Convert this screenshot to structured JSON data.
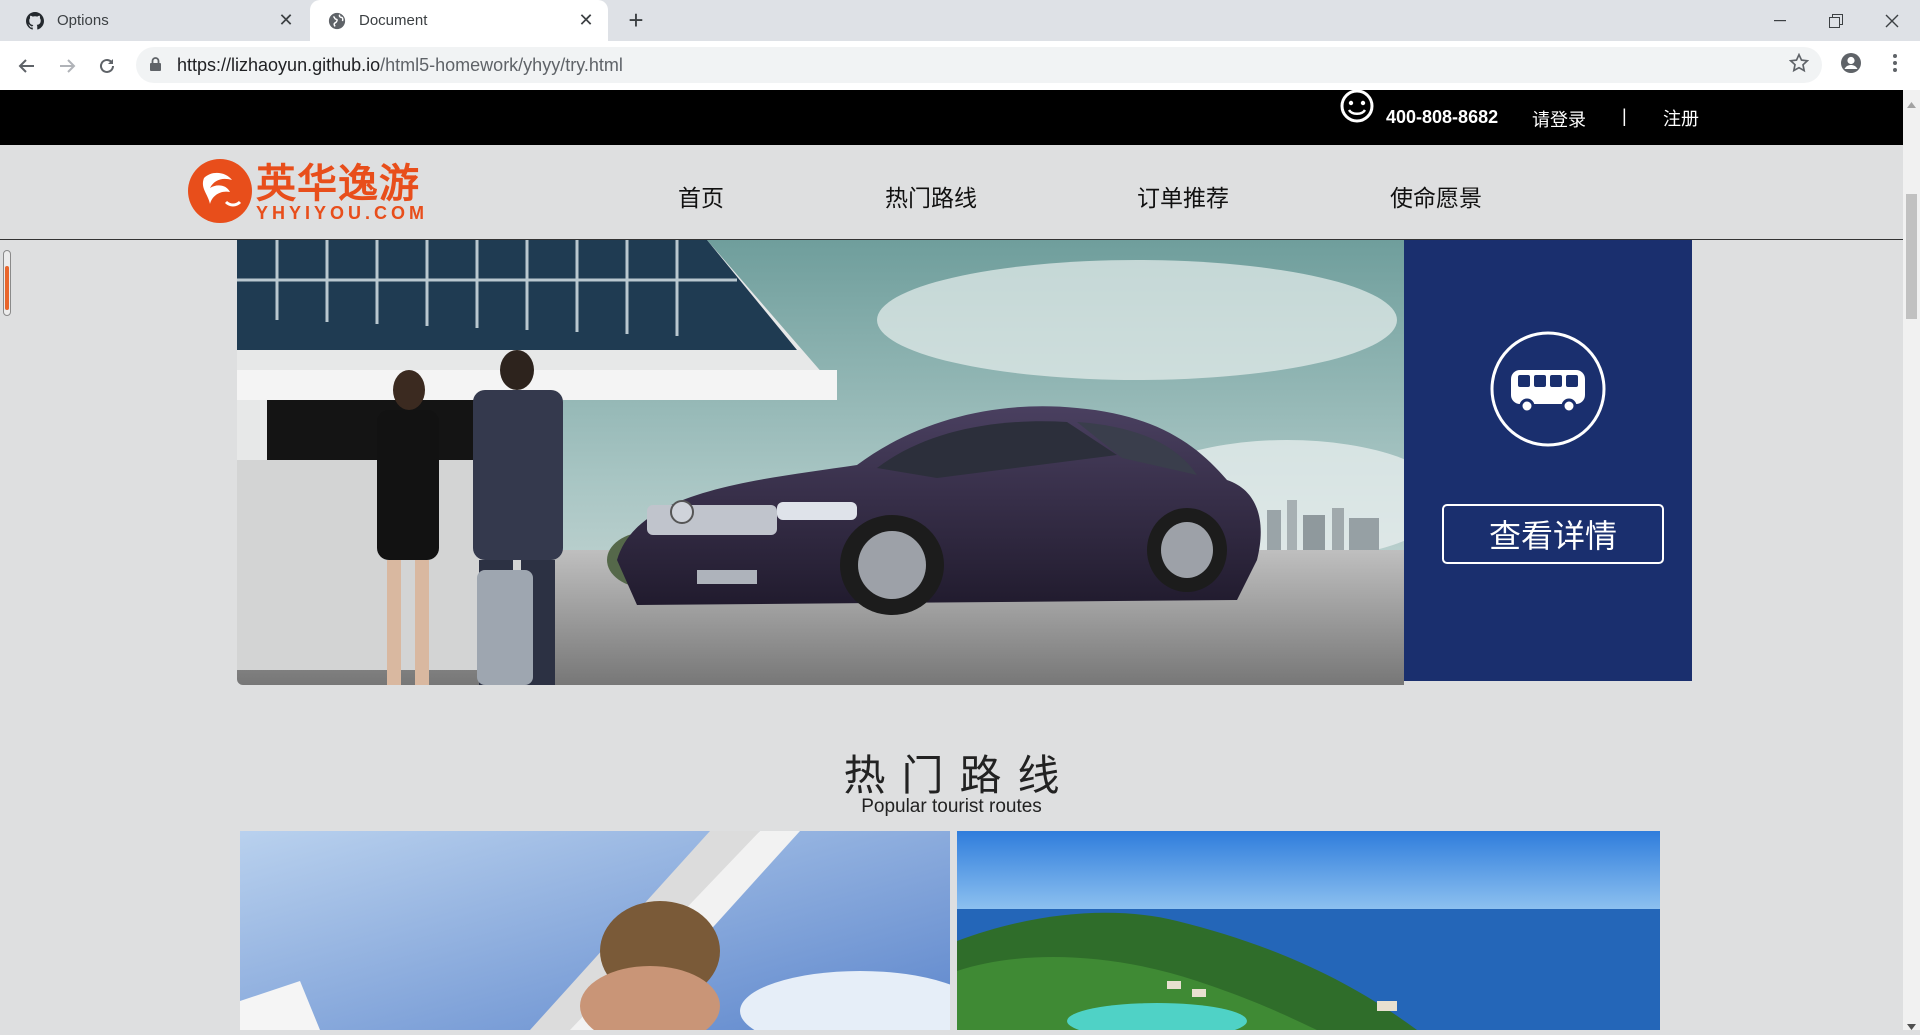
{
  "browser": {
    "tabs": [
      {
        "label": "Options",
        "icon": "github-icon"
      },
      {
        "label": "Document",
        "icon": "globe-icon",
        "active": true
      }
    ],
    "new_tab_symbol": "+",
    "close_symbol": "✕",
    "window_controls": {
      "minimize": "—",
      "restore": "❐",
      "close": "✕"
    },
    "url_host": "https://lizhaoyun.github.io",
    "url_path": "/html5-homework/yhyy/try.html"
  },
  "topbar": {
    "phone": "400-808-8682",
    "login": "请登录",
    "separator": "|",
    "register": "注册"
  },
  "nav": {
    "logo_cn": "英华逸游",
    "logo_en": "YHYIYOU.COM",
    "items": [
      "首页",
      "热门路线",
      "订单推荐",
      "使命愿景"
    ]
  },
  "banner": {
    "button_label": "查看详情",
    "side_color": "#1a2f6e"
  },
  "section": {
    "title": "热门路线",
    "subtitle": "Popular tourist routes"
  },
  "colors": {
    "brand_orange": "#e84e1b",
    "topbar_bg": "#000000",
    "page_bg": "#dedfe0"
  }
}
